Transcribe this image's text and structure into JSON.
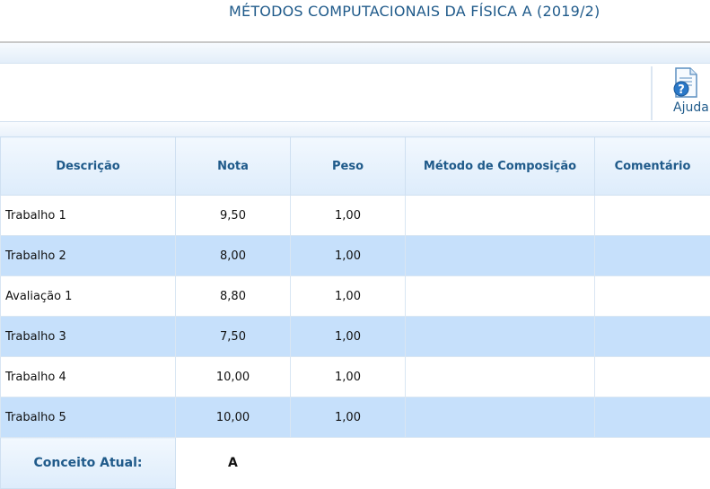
{
  "page": {
    "title": "MÉTODOS COMPUTACIONAIS DA FÍSICA A (2019/2)"
  },
  "toolbar": {
    "help_label": "Ajuda",
    "help_icon": "help-document-icon"
  },
  "table": {
    "headers": [
      "Descrição",
      "Nota",
      "Peso",
      "Método de Composição",
      "Comentário"
    ],
    "rows": [
      {
        "descricao": "Trabalho 1",
        "nota": "9,50",
        "peso": "1,00",
        "metodo": "",
        "comentario": ""
      },
      {
        "descricao": "Trabalho 2",
        "nota": "8,00",
        "peso": "1,00",
        "metodo": "",
        "comentario": ""
      },
      {
        "descricao": "Avaliação 1",
        "nota": "8,80",
        "peso": "1,00",
        "metodo": "",
        "comentario": ""
      },
      {
        "descricao": "Trabalho 3",
        "nota": "7,50",
        "peso": "1,00",
        "metodo": "",
        "comentario": ""
      },
      {
        "descricao": "Trabalho 4",
        "nota": "10,00",
        "peso": "1,00",
        "metodo": "",
        "comentario": ""
      },
      {
        "descricao": "Trabalho 5",
        "nota": "10,00",
        "peso": "1,00",
        "metodo": "",
        "comentario": ""
      }
    ],
    "summary": {
      "label": "Conceito Atual:",
      "value": "A"
    }
  },
  "colors": {
    "header_text": "#1f5a8a",
    "row_alt": "#c6e0fb",
    "row_base": "#ffffff"
  }
}
